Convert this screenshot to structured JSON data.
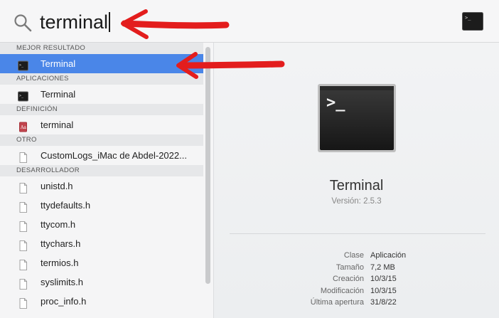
{
  "search": {
    "query": "terminal",
    "icon": "magnifier-icon"
  },
  "sections": [
    {
      "header": "MEJOR RESULTADO",
      "items": [
        {
          "label": "Terminal",
          "icon": "terminal-app-icon",
          "selected": true
        }
      ]
    },
    {
      "header": "APLICACIONES",
      "items": [
        {
          "label": "Terminal",
          "icon": "terminal-app-icon",
          "selected": false
        }
      ]
    },
    {
      "header": "DEFINICIÓN",
      "items": [
        {
          "label": "terminal",
          "icon": "dictionary-icon",
          "selected": false
        }
      ]
    },
    {
      "header": "OTRO",
      "items": [
        {
          "label": "CustomLogs_iMac de Abdel-2022...",
          "icon": "document-icon",
          "selected": false
        }
      ]
    },
    {
      "header": "DESARROLLADOR",
      "items": [
        {
          "label": "unistd.h",
          "icon": "document-icon"
        },
        {
          "label": "ttydefaults.h",
          "icon": "document-icon"
        },
        {
          "label": "ttycom.h",
          "icon": "document-icon"
        },
        {
          "label": "ttychars.h",
          "icon": "document-icon"
        },
        {
          "label": "termios.h",
          "icon": "document-icon"
        },
        {
          "label": "syslimits.h",
          "icon": "document-icon"
        },
        {
          "label": "proc_info.h",
          "icon": "document-icon"
        }
      ]
    }
  ],
  "preview": {
    "name": "Terminal",
    "version": "Versión: 2.5.3",
    "icon": "terminal-large-icon",
    "details": [
      {
        "label": "Clase",
        "value": "Aplicación"
      },
      {
        "label": "Tamaño",
        "value": "7,2 MB"
      },
      {
        "label": "Creación",
        "value": "10/3/15"
      },
      {
        "label": "Modificación",
        "value": "10/3/15"
      },
      {
        "label": "Última apertura",
        "value": "31/8/22"
      }
    ]
  },
  "colors": {
    "selection": "#4a86e8",
    "annotation": "#e31d1d"
  }
}
